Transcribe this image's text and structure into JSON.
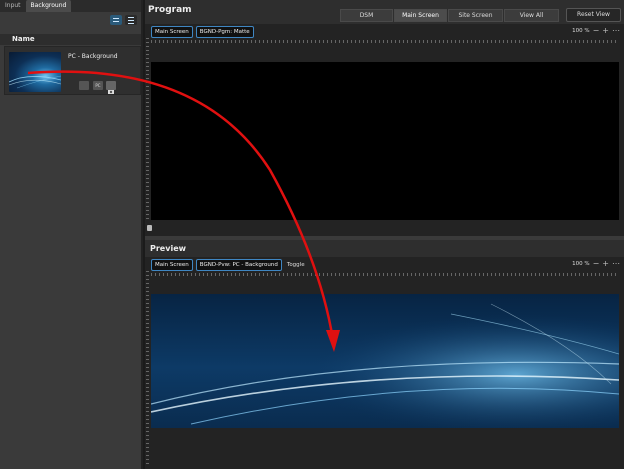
{
  "sidebar": {
    "tabs": [
      {
        "label": "Input"
      },
      {
        "label": "Background"
      }
    ],
    "name_header": "Name",
    "items": [
      {
        "title": "PC - Background",
        "badge": "PC"
      }
    ]
  },
  "program": {
    "title": "Program",
    "view_buttons": [
      {
        "label": "DSM"
      },
      {
        "label": "Main Screen"
      },
      {
        "label": "Site Screen"
      },
      {
        "label": "View All"
      }
    ],
    "reset_label": "Reset View",
    "crumbs": [
      "Main Screen",
      "BGND-Pgm: Matte"
    ],
    "zoom": "100 %"
  },
  "preview": {
    "title": "Preview",
    "crumbs": [
      "Main Screen",
      "BGND-Pvw: PC - Background"
    ],
    "toggle_label": "Toggle",
    "zoom": "100 %"
  },
  "colors": {
    "accent": "#3f86c2",
    "annotation_arrow": "#e01010"
  },
  "icons": [
    "grid-view-icon",
    "list-view-icon",
    "camera-icon",
    "lock-icon",
    "zoom-out-icon",
    "zoom-in-icon",
    "fit-icon"
  ]
}
